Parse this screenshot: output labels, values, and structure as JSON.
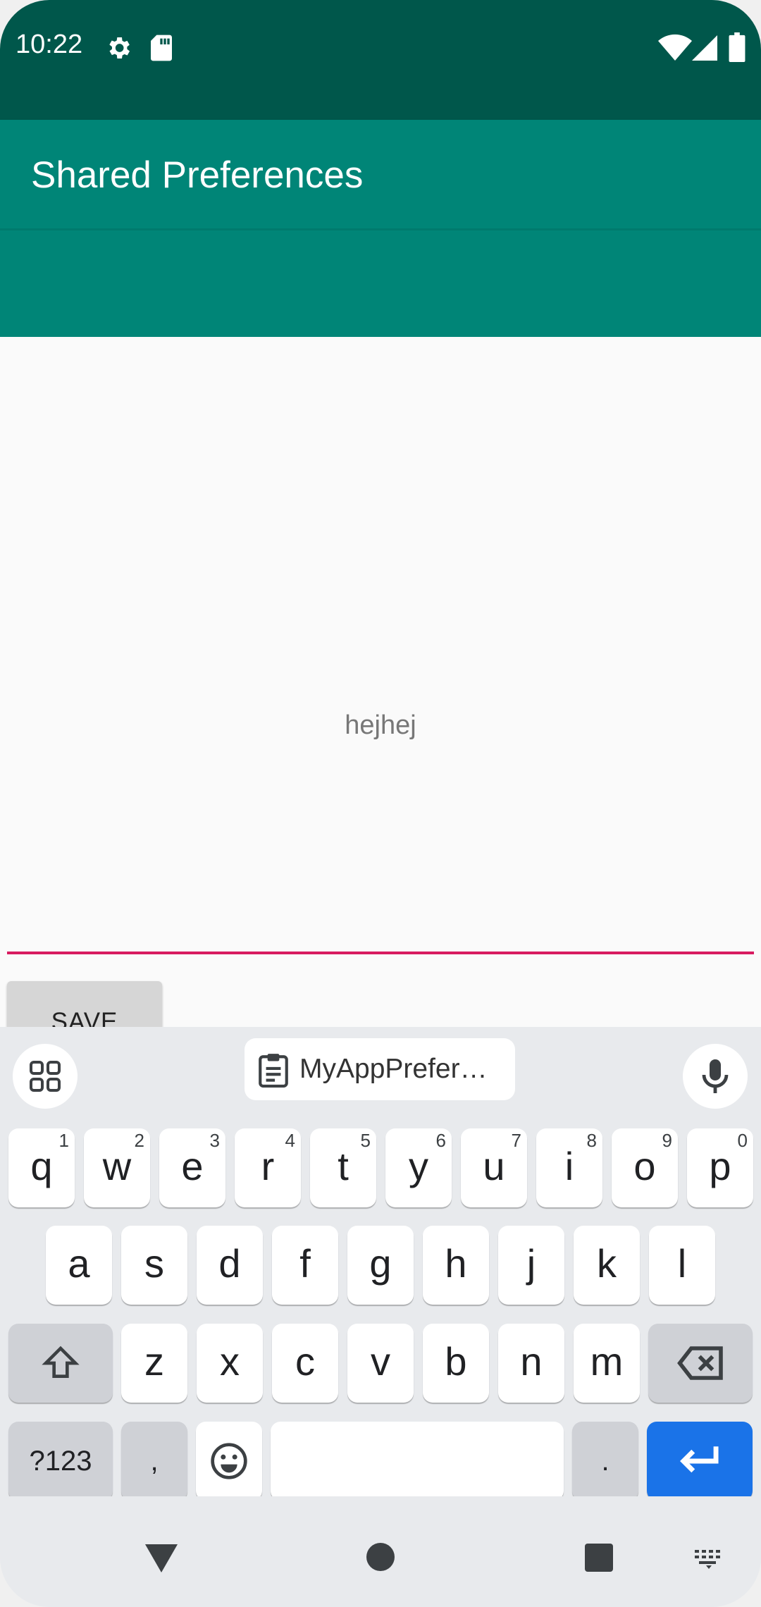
{
  "status_bar": {
    "time": "10:22",
    "icons_left": [
      "gear-icon",
      "sd-card-icon"
    ],
    "icons_right": [
      "wifi-icon",
      "cell-signal-icon",
      "battery-icon"
    ],
    "background": "#00574b"
  },
  "app_bar": {
    "title": "Shared Preferences",
    "background": "#008577"
  },
  "content": {
    "edit_text_value": "hejhej",
    "underline_color": "#d81b60",
    "save_label": "SAVE"
  },
  "keyboard": {
    "suggestion": "MyAppPrefer…",
    "row1": [
      {
        "key": "q",
        "hint": "1"
      },
      {
        "key": "w",
        "hint": "2"
      },
      {
        "key": "e",
        "hint": "3"
      },
      {
        "key": "r",
        "hint": "4"
      },
      {
        "key": "t",
        "hint": "5"
      },
      {
        "key": "y",
        "hint": "6"
      },
      {
        "key": "u",
        "hint": "7"
      },
      {
        "key": "i",
        "hint": "8"
      },
      {
        "key": "o",
        "hint": "9"
      },
      {
        "key": "p",
        "hint": "0"
      }
    ],
    "row2": [
      "a",
      "s",
      "d",
      "f",
      "g",
      "h",
      "j",
      "k",
      "l"
    ],
    "row3": [
      "z",
      "x",
      "c",
      "v",
      "b",
      "n",
      "m"
    ],
    "symbols_label": "?123",
    "comma_label": ",",
    "period_label": ".",
    "enter_color": "#1a73e8"
  },
  "nav_bar": {
    "buttons": [
      "back-icon",
      "home-icon",
      "recents-icon",
      "keyboard-switch-icon"
    ]
  }
}
